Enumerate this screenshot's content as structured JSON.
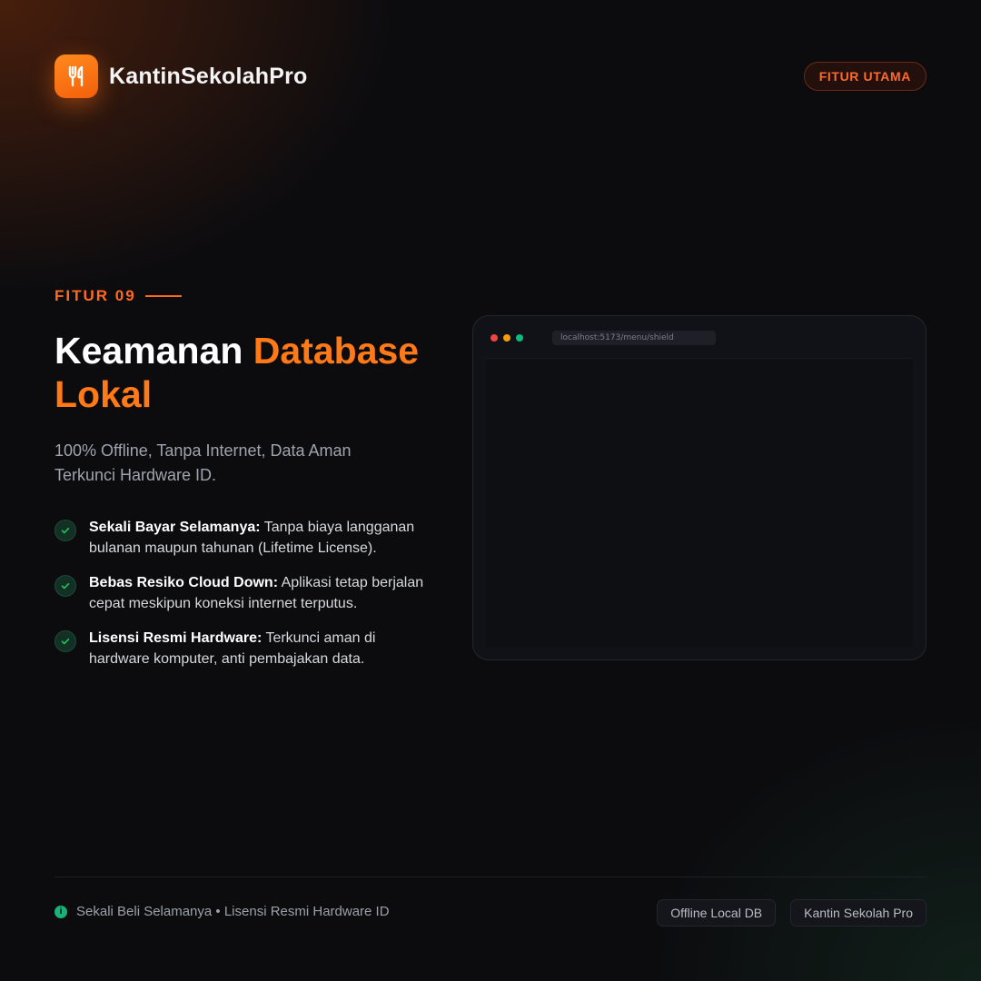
{
  "brand": {
    "name": "KantinSekolahPro",
    "logo_icon": "fork-knife-icon"
  },
  "header": {
    "badge": "FITUR UTAMA"
  },
  "feature": {
    "tag": "FITUR 09",
    "title_part1": "Keamanan",
    "title_accent": "Database Lokal",
    "subtitle": "100% Offline, Tanpa Internet, Data Aman Terkunci Hardware ID."
  },
  "bullets": [
    {
      "strong": "Sekali Bayar Selamanya:",
      "text": " Tanpa biaya langganan bulanan maupun tahunan (Lifetime License)."
    },
    {
      "strong": "Bebas Resiko Cloud Down:",
      "text": " Aplikasi tetap berjalan cepat meskipun koneksi internet terputus."
    },
    {
      "strong": "Lisensi Resmi Hardware:",
      "text": " Terkunci aman di hardware komputer, anti pembajakan data."
    }
  ],
  "browser": {
    "url": "localhost:5173/menu/shield"
  },
  "footer": {
    "note": "Sekali Beli Selamanya • Lisensi Resmi Hardware ID",
    "chips": [
      "Offline Local DB",
      "Kantin Sekolah Pro"
    ]
  },
  "colors": {
    "accent": "#ff7a16",
    "dot_red": "#ef4444",
    "dot_yellow": "#f59e0b",
    "dot_green": "#10b981",
    "check_green": "#22c55e"
  }
}
